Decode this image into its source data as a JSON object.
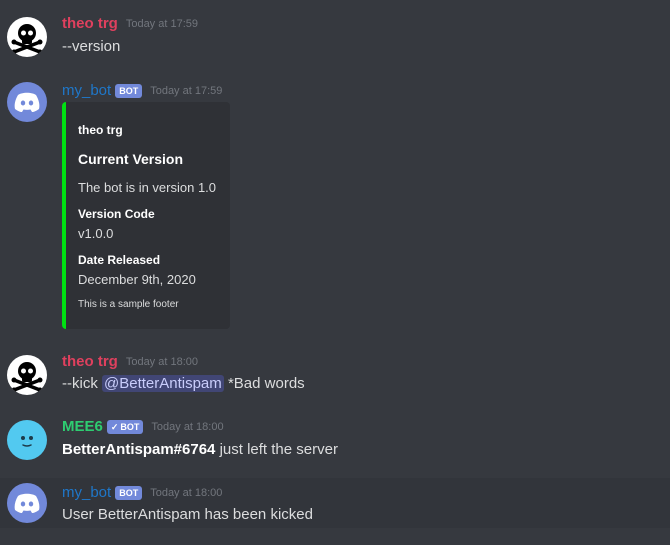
{
  "messages": [
    {
      "author": "theo trg",
      "timestamp": "Today at 17:59",
      "text": "--version"
    },
    {
      "author": "my_bot",
      "badge": "BOT",
      "timestamp": "Today at 17:59",
      "embed": {
        "author": "theo trg",
        "title": "Current Version",
        "description": "The bot is in version 1.0",
        "fields": [
          {
            "name": "Version Code",
            "value": "v1.0.0"
          },
          {
            "name": "Date Released",
            "value": "December 9th, 2020"
          }
        ],
        "footer": "This is a sample footer",
        "color": "#00e012"
      }
    },
    {
      "author": "theo trg",
      "timestamp": "Today at 18:00",
      "text_prefix": "--kick",
      "mention": "@BetterAntispam",
      "text_suffix": "*Bad words"
    },
    {
      "author": "MEE6",
      "badge": "BOT",
      "badge_check": "✓",
      "timestamp": "Today at 18:00",
      "bold_part": "BetterAntispam#6764",
      "text_suffix": "just left the server"
    },
    {
      "author": "my_bot",
      "badge": "BOT",
      "timestamp": "Today at 18:00",
      "text": "User BetterAntispam has been kicked"
    }
  ],
  "icons": {
    "skull": "skull-crossbones-icon",
    "discord": "discord-logo-icon",
    "mee6": "mee6-face-icon"
  },
  "colors": {
    "background": "#36393f",
    "embed_bg": "#2f3136",
    "embed_accent": "#00e012",
    "bot_badge": "#7289da",
    "user_red": "#e0405e",
    "bot_blue": "#1f77c9",
    "mee6_green": "#2ecc71"
  }
}
